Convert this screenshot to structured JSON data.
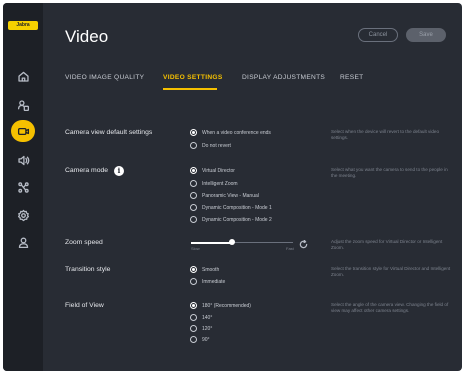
{
  "app": {
    "logo_text": "Jabra"
  },
  "sidebar": {
    "items": [
      {
        "name": "home",
        "icon": "home-icon"
      },
      {
        "name": "devices",
        "icon": "devices-icon"
      },
      {
        "name": "video",
        "icon": "video-camera-icon",
        "active": true
      },
      {
        "name": "audio",
        "icon": "speaker-icon"
      },
      {
        "name": "connections",
        "icon": "network-icon"
      },
      {
        "name": "settings",
        "icon": "gear-icon"
      },
      {
        "name": "account",
        "icon": "user-icon"
      }
    ]
  },
  "header": {
    "title": "Video",
    "cancel_label": "Cancel",
    "save_label": "Save"
  },
  "tabs": [
    {
      "label": "VIDEO IMAGE QUALITY",
      "active": false
    },
    {
      "label": "VIDEO SETTINGS",
      "active": true
    },
    {
      "label": "DISPLAY ADJUSTMENTS",
      "active": false
    },
    {
      "label": "RESET",
      "active": false
    }
  ],
  "settings": {
    "camera_default": {
      "label": "Camera view default settings",
      "options": [
        "When a video conference ends",
        "Do not revert"
      ],
      "selected": 0,
      "description": "Select when the device will revert to the default video settings."
    },
    "camera_mode": {
      "label": "Camera mode",
      "info_glyph": "i",
      "options": [
        "Virtual Director",
        "Intelligent Zoom",
        "Panoramic View - Manual",
        "Dynamic Composition - Mode 1",
        "Dynamic Composition - Mode 2"
      ],
      "selected": 0,
      "description": "Select what you want the camera to send to the people in the meeting."
    },
    "zoom_speed": {
      "label": "Zoom speed",
      "min_label": "Slow",
      "max_label": "Fast",
      "value": 0.4,
      "description": "Adjust the zoom speed for Virtual Director or Intelligent Zoom."
    },
    "transition_style": {
      "label": "Transition style",
      "options": [
        "Smooth",
        "Immediate"
      ],
      "selected": 0,
      "description": "Select the transition style for Virtual Director and Intelligent Zoom."
    },
    "field_of_view": {
      "label": "Field of View",
      "options": [
        "180° (Recommended)",
        "140°",
        "120°",
        "90°"
      ],
      "selected": 0,
      "description": "Select the angle of the camera view. Changing the field of view may affect other camera settings."
    }
  },
  "colors": {
    "accent": "#f5c000",
    "background": "#282c34",
    "sidebar": "#1d2026"
  }
}
